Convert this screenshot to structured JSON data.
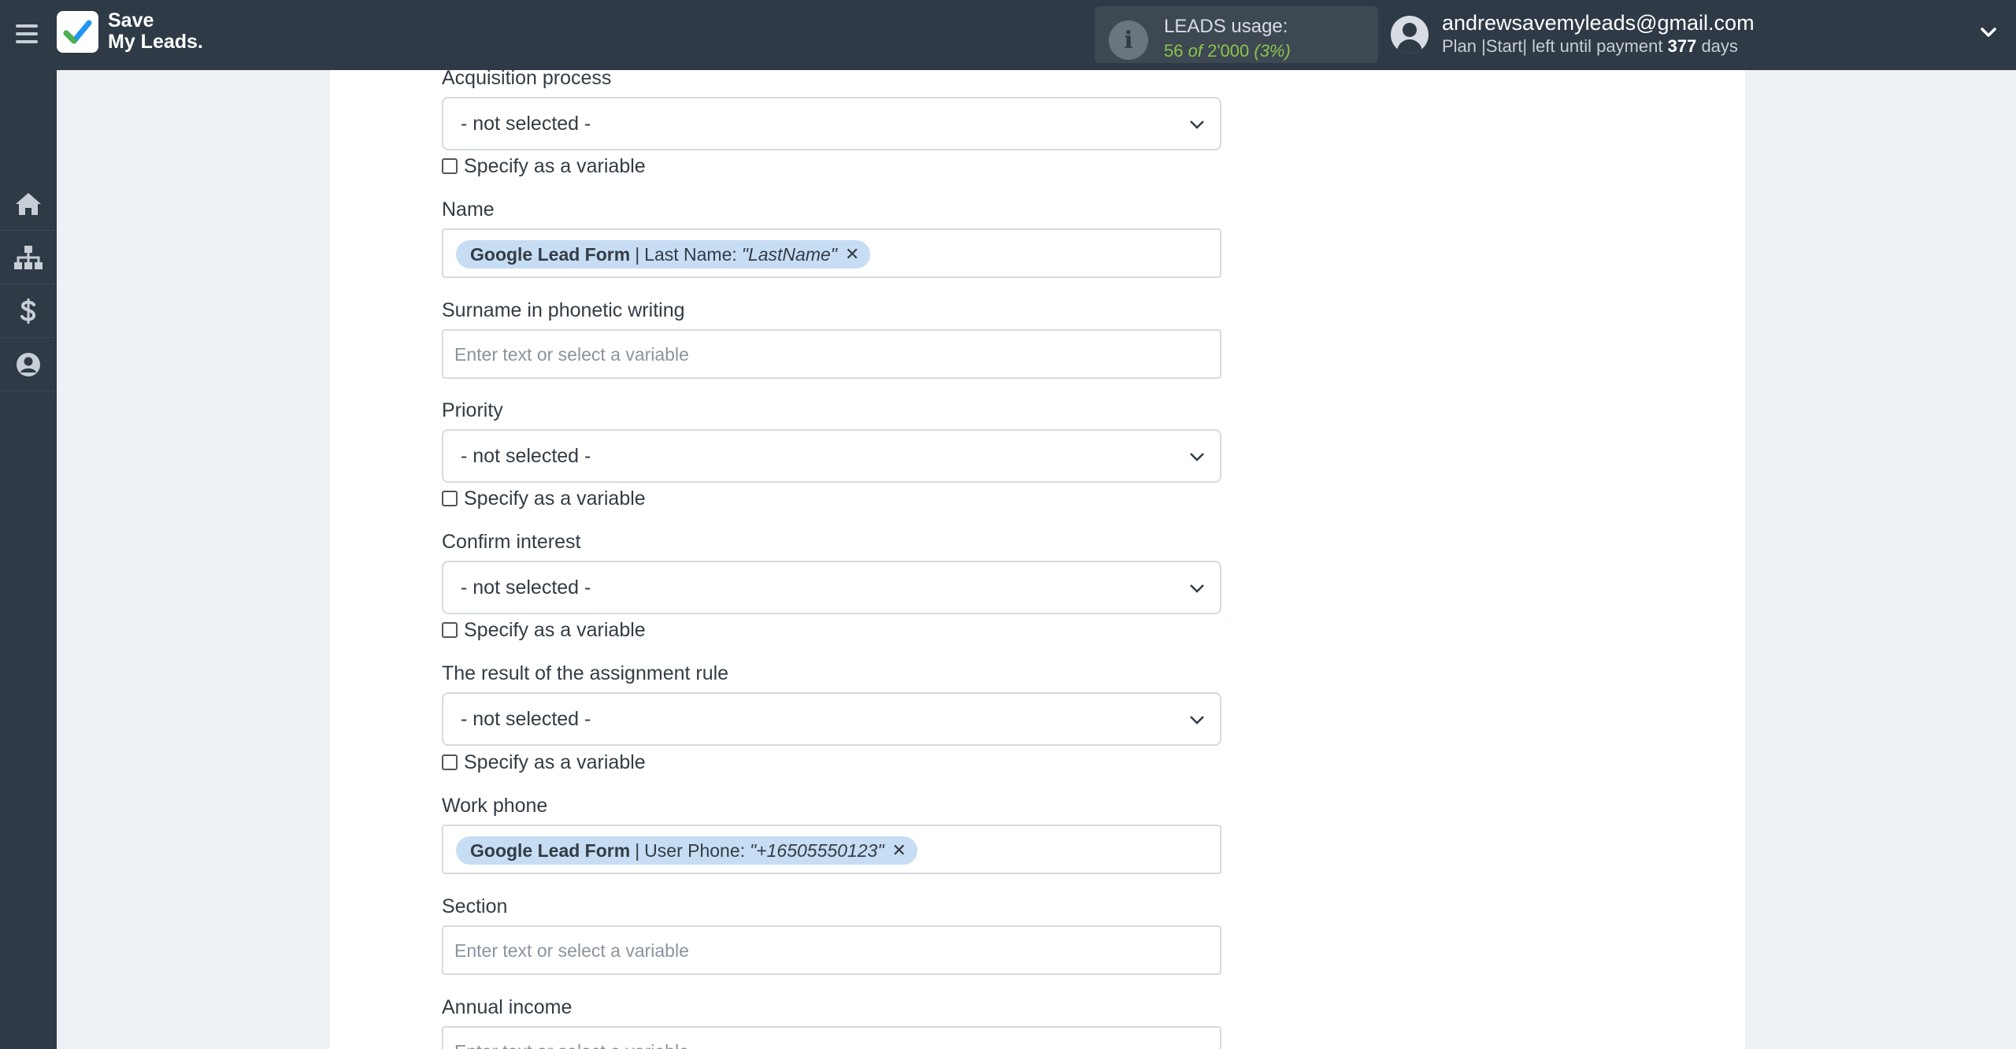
{
  "header": {
    "logo_line1": "Save",
    "logo_line2": "My Leads.",
    "usage": {
      "label": "LEADS usage:",
      "used": "56",
      "of": "of",
      "limit": "2'000",
      "percent": "(3%)"
    },
    "user": {
      "email": "andrewsavemyleads@gmail.com",
      "plan_prefix": "Plan |Start| left until payment",
      "days": "377",
      "days_suffix": "days"
    }
  },
  "sidebar": {
    "items": [
      {
        "icon": "home-icon"
      },
      {
        "icon": "sitemap-icon"
      },
      {
        "icon": "dollar-icon"
      },
      {
        "icon": "user-circle-icon"
      }
    ]
  },
  "form": {
    "acquisition": {
      "label": "Acquisition process",
      "value": "- not selected -",
      "checkbox": "Specify as a variable"
    },
    "name": {
      "label": "Name",
      "tag_source": "Google Lead Form",
      "tag_field": "Last Name:",
      "tag_value": "\"LastName\""
    },
    "surname_phonetic": {
      "label": "Surname in phonetic writing",
      "placeholder": "Enter text or select a variable"
    },
    "priority": {
      "label": "Priority",
      "value": "- not selected -",
      "checkbox": "Specify as a variable"
    },
    "confirm_interest": {
      "label": "Confirm interest",
      "value": "- not selected -",
      "checkbox": "Specify as a variable"
    },
    "assignment_rule": {
      "label": "The result of the assignment rule",
      "value": "- not selected -",
      "checkbox": "Specify as a variable"
    },
    "work_phone": {
      "label": "Work phone",
      "tag_source": "Google Lead Form",
      "tag_field": "User Phone:",
      "tag_value": "\"+16505550123\""
    },
    "section": {
      "label": "Section",
      "placeholder": "Enter text or select a variable"
    },
    "annual_income": {
      "label": "Annual income",
      "placeholder": "Enter text or select a variable"
    }
  },
  "colors": {
    "topbar": "#2e3a46",
    "tag_bg": "#c6ddf4",
    "usage_green": "#8bc34a"
  }
}
